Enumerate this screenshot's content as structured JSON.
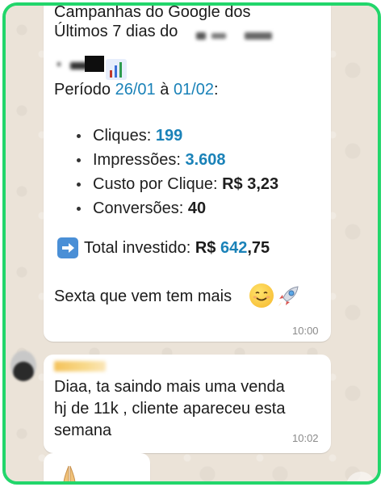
{
  "message1": {
    "line1": "Campanhas do Google dos",
    "line2": "Últimos 7 dias do",
    "periodo_label": "Período",
    "date_start": "26/01",
    "date_sep": "à",
    "date_end": "01/02",
    "date_colon": ":",
    "metrics": {
      "cliques_label": "Cliques:",
      "cliques_value": "199",
      "impressoes_label": "Impressões:",
      "impressoes_value": "3.608",
      "cpc_label": "Custo por Clique:",
      "cpc_value": "R$ 3,23",
      "conversoes_label": "Conversões:",
      "conversoes_value": "40"
    },
    "total_label": "Total investido:",
    "total_currency": "R$",
    "total_int": "642",
    "total_dec": ",75",
    "closing": "Sexta que vem tem mais",
    "time": "10:00",
    "icons": [
      "chart-icon",
      "arrow-right-icon",
      "smile-emoji",
      "rocket-emoji"
    ]
  },
  "message2": {
    "line1": "Diaa, ta saindo mais uma venda",
    "line2": "hj de 11k , cliente apareceu esta",
    "line3": "semana",
    "time": "10:02"
  },
  "message3": {
    "icon": "praying-hands-emoji"
  },
  "colors": {
    "border": "#22d66b",
    "link": "#1a82b8",
    "wallpaper": "#ebe3d8"
  }
}
